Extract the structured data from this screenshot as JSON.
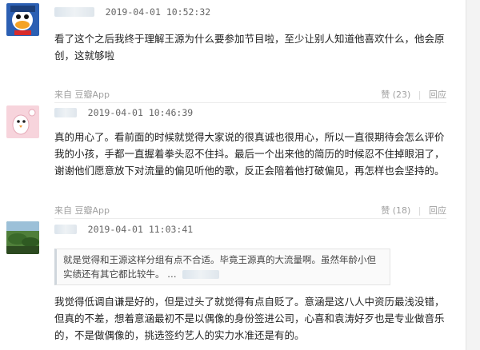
{
  "comments": [
    {
      "time": "2019-04-01 10:52:32",
      "text": "看了这个之后我终于理解王源为什么要参加节目啦，至少让别人知道他喜欢什么，他会原创，这就够啦",
      "source": "来自 豆瓣App",
      "likes": "赞 (23)",
      "reply": "回应"
    },
    {
      "time": "2019-04-01 10:46:39",
      "text": "真的用心了。看前面的时候就觉得大家说的很真诚也很用心，所以一直很期待会怎么评价我的小孩，手都一直握着拳头忍不住抖。最后一个出来他的简历的时候忍不住掉眼泪了，谢谢他们愿意放下对流量的偏见听他的歌，反正会陪着他打破偏见，再怎样也会坚持的。",
      "source": "来自 豆瓣App",
      "likes": "赞 (18)",
      "reply": "回应"
    },
    {
      "time": "2019-04-01 11:03:41",
      "quote": "就是觉得和王源这样分组有点不合适。毕竟王源真的大流量啊。虽然年龄小但实绩还有其它都比较牛。 …",
      "text": "我觉得低调自谦是好的，但是过头了就觉得有点自贬了。意涵是这八人中资历最浅没错，但真的不差，想着意涵最初不是以偶像的身份签进公司，心喜和袁涛好歹也是专业做音乐的，不是做偶像的，挑选签约艺人的实力水准还是有的。"
    }
  ],
  "colors": {
    "footer_text": "#a0a0a0",
    "divider": "#ececec"
  }
}
